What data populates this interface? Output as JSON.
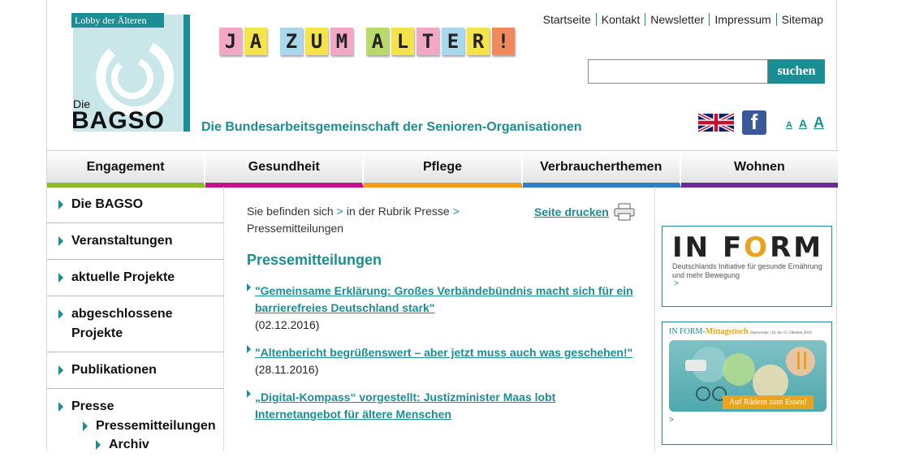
{
  "logo": {
    "tagline": "Lobby der Älteren",
    "die": "Die",
    "name": "BAGSO"
  },
  "slogan": {
    "tiles": [
      {
        "ch": "J",
        "color": "#f2a7c4"
      },
      {
        "ch": "A",
        "color": "#f5e34a"
      },
      {
        "ch": "",
        "color": ""
      },
      {
        "ch": "Z",
        "color": "#a8d8ee"
      },
      {
        "ch": "U",
        "color": "#f5e34a"
      },
      {
        "ch": "M",
        "color": "#f2a7c4"
      },
      {
        "ch": "",
        "color": ""
      },
      {
        "ch": "A",
        "color": "#b9d96a"
      },
      {
        "ch": "L",
        "color": "#f5e34a"
      },
      {
        "ch": "T",
        "color": "#f2a7c4"
      },
      {
        "ch": "E",
        "color": "#a8d8ee"
      },
      {
        "ch": "R",
        "color": "#f5e34a"
      },
      {
        "ch": "!",
        "color": "#f08a5d"
      }
    ]
  },
  "org_name": "Die Bundesarbeitsgemeinschaft der Senioren-Organisationen",
  "topnav": [
    "Startseite",
    "Kontakt",
    "Newsletter",
    "Impressum",
    "Sitemap"
  ],
  "search": {
    "value": "",
    "placeholder": "",
    "button": "suchen"
  },
  "tools": {
    "facebook": "f",
    "font_small": "A",
    "font_medium": "A",
    "font_large": "A"
  },
  "mainnav": [
    {
      "label": "Engagement",
      "color": "#8dbb2a"
    },
    {
      "label": "Gesundheit",
      "color": "#c5118a"
    },
    {
      "label": "Pflege",
      "color": "#f29b1d"
    },
    {
      "label": "Verbraucherthemen",
      "color": "#2c7fc3"
    },
    {
      "label": "Wohnen",
      "color": "#6b2a9a"
    }
  ],
  "sidebar": {
    "items": [
      "Die BAGSO",
      "Veranstaltungen",
      "aktuelle Projekte",
      "abgeschlossene Projekte",
      "Publikationen"
    ],
    "open": {
      "label": "Presse",
      "sub": "Pressemitteilungen",
      "sub2": "Archiv"
    }
  },
  "breadcrumb": {
    "prefix": "Sie befinden sich",
    "sep": ">",
    "rubrik": "in der Rubrik",
    "presse": "Presse",
    "current": "Pressemitteilungen"
  },
  "print_label": "Seite drucken",
  "heading": "Pressemitteilungen",
  "news": [
    {
      "title": "\"Gemeinsame Erklärung: Großes Verbändebündnis macht sich für ein barrierefreies Deutschland stark\"",
      "date": "(02.12.2016)"
    },
    {
      "title": "\"Altenbericht begrüßenswert – aber jetzt muss auch was geschehen!\"",
      "date": "(28.11.2016)"
    },
    {
      "title": "„Digital-Kompass“ vorgestellt: Justizminister Maas lobt Internetangebot für ältere Menschen",
      "date": ""
    }
  ],
  "promo1": {
    "logo_pre": "IN F",
    "logo_o": "O",
    "logo_post": "RM",
    "sub": "Deutschlands Initiative für gesunde Ernährung und mehr Bewegung",
    "more": ">"
  },
  "promo2": {
    "title_a": "IN FORM-",
    "title_b": "Mittagstisch",
    "dates": "Startwoche | 10. bis 15. Oktober 2016",
    "banner": "Auf Rädern zum Essen!",
    "more": ">"
  },
  "colors": {
    "accent": "#1b8e93"
  }
}
